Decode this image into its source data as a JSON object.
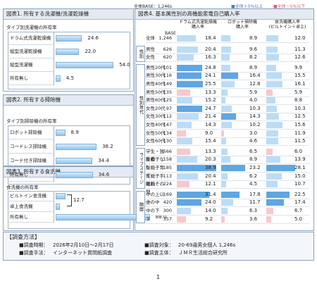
{
  "header": {
    "base_note": "全体BASE：1,246s",
    "legend_high": "■全体＋5%以上",
    "legend_low": "■全体－5%以下",
    "legend_high_color": "#5fa6e3",
    "legend_low_color": "#f6a5ab"
  },
  "fig1": {
    "title": "図表1. 所有する洗濯機/洗濯乾燥機",
    "subtitle": "タイプ別洗濯機の所有率",
    "items": [
      {
        "label": "ドラム式洗濯乾燥機",
        "value": 24.6
      },
      {
        "label": "縦型洗濯乾燥機",
        "value": 22.0
      },
      {
        "label": "縦型洗濯機",
        "value": 54.0
      },
      {
        "label": "所有無し",
        "value": 4.5
      }
    ]
  },
  "fig2": {
    "title": "図表2. 所有する掃除機",
    "subtitle": "タイプ別掃除機の所有率",
    "items": [
      {
        "label": "ロボット掃除機",
        "value": 8.9
      },
      {
        "label": "コードレス掃除機",
        "value": 38.2
      },
      {
        "label": "コード付き掃除機",
        "value": 34.4
      },
      {
        "label": "所有無し",
        "value": 34.6
      }
    ]
  },
  "fig3": {
    "title": "図表3. 所有する食洗機",
    "subtitle": "食洗機の所有率",
    "items": [
      {
        "label": "ビルトイン食洗機",
        "value": null
      },
      {
        "label": "卓上食洗機",
        "value": null
      },
      {
        "label": "所有無し",
        "value": 88.0
      }
    ],
    "bracket_value": "12.7"
  },
  "fig4": {
    "title": "図表4. 基本属性別の高機能家電自己購入率",
    "base_label": "BASE",
    "col_headers": [
      "ドラム式洗濯乾燥機\n購入率",
      "ロボット掃除機\n購入率",
      "食洗機購入率\n(ビルトイン＋卓上)"
    ],
    "total": {
      "label": "全体",
      "n": "1,246",
      "v": [
        18.4,
        8.9,
        12.0
      ]
    },
    "groups": [
      {
        "name": "性別",
        "rows": [
          {
            "label": "男性",
            "n": "626",
            "v": [
              20.4,
              9.6,
              11.3
            ],
            "h": [
              0,
              0,
              0
            ]
          },
          {
            "label": "女性",
            "n": "620",
            "v": [
              16.3,
              8.2,
              12.6
            ],
            "h": [
              0,
              0,
              0
            ]
          }
        ]
      },
      {
        "name": "性別年代",
        "rows": [
          {
            "label": "男性20代",
            "n": "101",
            "v": [
              24.8,
              8.9,
              9.9
            ],
            "h": [
              1,
              0,
              0
            ]
          },
          {
            "label": "男性30代",
            "n": "116",
            "v": [
              24.1,
              16.4,
              15.5
            ],
            "h": [
              1,
              1,
              0
            ]
          },
          {
            "label": "男性40代",
            "n": "149",
            "v": [
              25.5,
              12.8,
              16.1
            ],
            "h": [
              1,
              0,
              0
            ]
          },
          {
            "label": "男性50代",
            "n": "135",
            "v": [
              13.3,
              5.9,
              5.9
            ],
            "h": [
              -1,
              0,
              -1
            ]
          },
          {
            "label": "男性60代",
            "n": "125",
            "v": [
              15.2,
              4.0,
              8.8
            ],
            "h": [
              0,
              0,
              0
            ]
          },
          {
            "label": "女性20代",
            "n": "97",
            "v": [
              24.7,
              10.3,
              10.3
            ],
            "h": [
              1,
              0,
              0
            ]
          },
          {
            "label": "女性30代",
            "n": "112",
            "v": [
              21.4,
              14.3,
              12.5
            ],
            "h": [
              0,
              1,
              0
            ]
          },
          {
            "label": "女性40代",
            "n": "147",
            "v": [
              14.3,
              10.2,
              15.6
            ],
            "h": [
              0,
              0,
              0
            ]
          },
          {
            "label": "女性50代",
            "n": "134",
            "v": [
              9.0,
              3.0,
              11.9
            ],
            "h": [
              -1,
              -1,
              0
            ]
          },
          {
            "label": "女性60代",
            "n": "130",
            "v": [
              15.4,
              4.6,
              11.5
            ],
            "h": [
              0,
              0,
              0
            ]
          }
        ]
      },
      {
        "name": "ライフステージ",
        "rows": [
          {
            "label": "学生・独身者",
            "n": "566",
            "v": [
              13.3,
              6.5,
              6.0
            ],
            "h": [
              -1,
              0,
              -1
            ]
          },
          {
            "label": "既婚子なし",
            "n": "158",
            "v": [
              20.3,
              8.9,
              13.9
            ],
            "h": [
              0,
              0,
              0
            ]
          },
          {
            "label": "既婚子育て",
            "n": "185",
            "v": [
              38.9,
              23.2,
              28.1
            ],
            "h": [
              1,
              1,
              1
            ]
          },
          {
            "label": "既婚子手離れ",
            "n": "113",
            "v": [
              20.4,
              6.2,
              15.0
            ],
            "h": [
              0,
              0,
              0
            ]
          },
          {
            "label": "既婚その他",
            "n": "224",
            "v": [
              12.1,
              4.5,
              10.7
            ],
            "h": [
              -1,
              0,
              0
            ]
          }
        ]
      },
      {
        "name": "階層",
        "rows": [
          {
            "label": "中の上以上",
            "n": "169",
            "v": [
              31.4,
              17.8,
              22.5
            ],
            "h": [
              1,
              1,
              1
            ]
          },
          {
            "label": "中の中",
            "n": "420",
            "v": [
              24.0,
              11.7,
              17.4
            ],
            "h": [
              1,
              0,
              1
            ]
          },
          {
            "label": "中の下",
            "n": "300",
            "v": [
              14.0,
              6.3,
              6.7
            ],
            "h": [
              0,
              0,
              -1
            ]
          },
          {
            "label": "下",
            "n": "357",
            "v": [
              9.2,
              3.6,
              5.0
            ],
            "h": [
              -1,
              -1,
              -1
            ]
          }
        ]
      }
    ]
  },
  "method": {
    "title": "【調査方法】",
    "items": [
      {
        "k": "■調査時期：",
        "v": "2026年2月10日～2月17日"
      },
      {
        "k": "■調査対象：",
        "v": "20-69歳男女個人 1,246s"
      },
      {
        "k": "■調査手法：",
        "v": "インターネット質問紙調査"
      },
      {
        "k": "■調査主体：",
        "v": "ＪＭＲ生活総合研究所"
      }
    ]
  },
  "page_number": "1"
}
